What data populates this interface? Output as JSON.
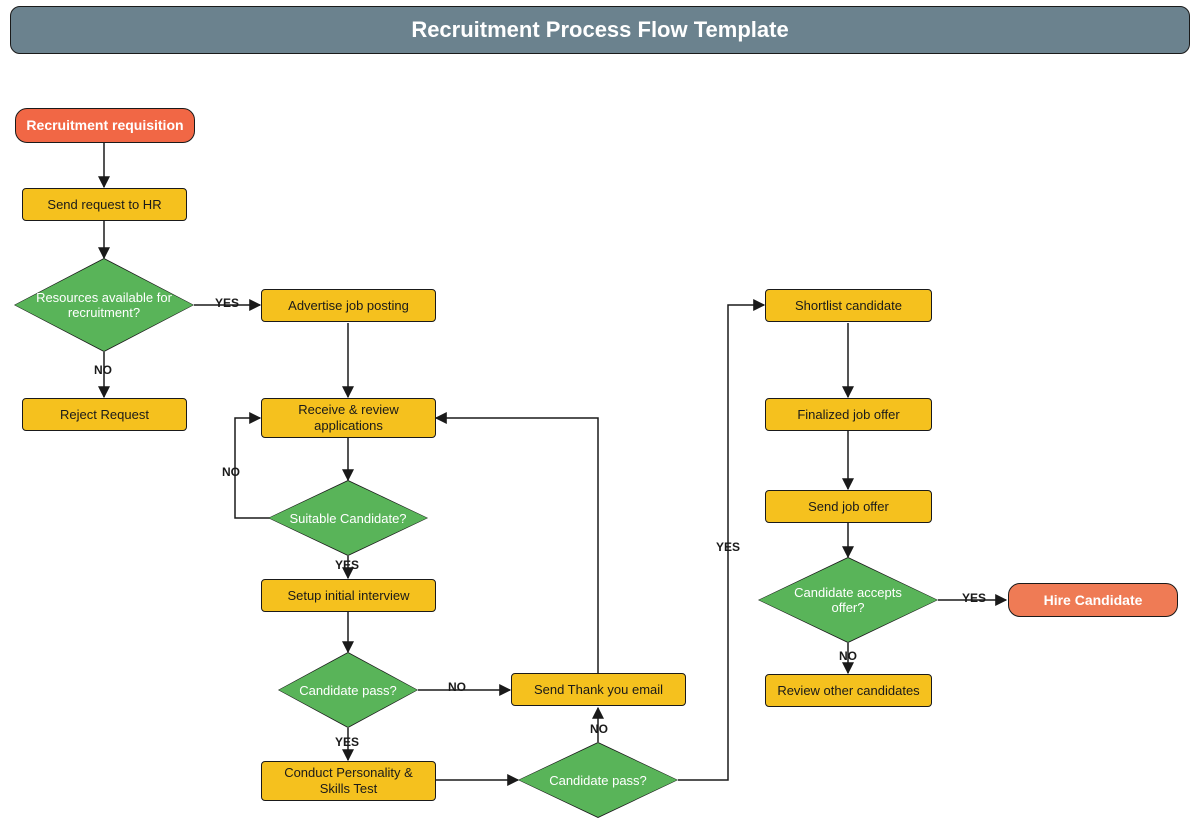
{
  "title": "Recruitment Process Flow Template",
  "colors": {
    "header": "#6b828e",
    "terminator": "#f16745",
    "terminatorEnd": "#ef7b55",
    "process": "#f5c11e",
    "decision": "#59b459",
    "stroke": "#1a1a1a"
  },
  "nodes": {
    "start": "Recruitment requisition",
    "sendHR": "Send request to HR",
    "resources": "Resources available for recruitment?",
    "reject": "Reject Request",
    "advertise": "Advertise job posting",
    "receive": "Receive & review applications",
    "suitable": "Suitable Candidate?",
    "setup": "Setup initial interview",
    "pass1": "Candidate pass?",
    "thankyou": "Send Thank you email",
    "conduct": "Conduct Personality & Skills Test",
    "pass2": "Candidate pass?",
    "shortlist": "Shortlist candidate",
    "finalize": "Finalized job offer",
    "sendoffer": "Send job offer",
    "accepts": "Candidate accepts offer?",
    "hire": "Hire Candidate",
    "reviewother": "Review other candidates"
  },
  "labels": {
    "yes": "YES",
    "no": "NO"
  },
  "chart_data": {
    "type": "flowchart",
    "title": "Recruitment Process Flow Template",
    "nodes": [
      {
        "id": "start",
        "type": "terminator",
        "label": "Recruitment requisition"
      },
      {
        "id": "sendHR",
        "type": "process",
        "label": "Send request to HR"
      },
      {
        "id": "resources",
        "type": "decision",
        "label": "Resources available for recruitment?"
      },
      {
        "id": "reject",
        "type": "process",
        "label": "Reject Request"
      },
      {
        "id": "advertise",
        "type": "process",
        "label": "Advertise job posting"
      },
      {
        "id": "receive",
        "type": "process",
        "label": "Receive & review applications"
      },
      {
        "id": "suitable",
        "type": "decision",
        "label": "Suitable Candidate?"
      },
      {
        "id": "setup",
        "type": "process",
        "label": "Setup initial interview"
      },
      {
        "id": "pass1",
        "type": "decision",
        "label": "Candidate pass?"
      },
      {
        "id": "thankyou",
        "type": "process",
        "label": "Send Thank you email"
      },
      {
        "id": "conduct",
        "type": "process",
        "label": "Conduct Personality & Skills Test"
      },
      {
        "id": "pass2",
        "type": "decision",
        "label": "Candidate pass?"
      },
      {
        "id": "shortlist",
        "type": "process",
        "label": "Shortlist candidate"
      },
      {
        "id": "finalize",
        "type": "process",
        "label": "Finalized job offer"
      },
      {
        "id": "sendoffer",
        "type": "process",
        "label": "Send job offer"
      },
      {
        "id": "accepts",
        "type": "decision",
        "label": "Candidate accepts offer?"
      },
      {
        "id": "hire",
        "type": "terminator",
        "label": "Hire Candidate"
      },
      {
        "id": "reviewother",
        "type": "process",
        "label": "Review other candidates"
      }
    ],
    "edges": [
      {
        "from": "start",
        "to": "sendHR"
      },
      {
        "from": "sendHR",
        "to": "resources"
      },
      {
        "from": "resources",
        "to": "advertise",
        "label": "YES"
      },
      {
        "from": "resources",
        "to": "reject",
        "label": "NO"
      },
      {
        "from": "advertise",
        "to": "receive"
      },
      {
        "from": "receive",
        "to": "suitable"
      },
      {
        "from": "suitable",
        "to": "setup",
        "label": "YES"
      },
      {
        "from": "suitable",
        "to": "receive",
        "label": "NO"
      },
      {
        "from": "setup",
        "to": "pass1"
      },
      {
        "from": "pass1",
        "to": "conduct",
        "label": "YES"
      },
      {
        "from": "pass1",
        "to": "thankyou",
        "label": "NO"
      },
      {
        "from": "conduct",
        "to": "pass2"
      },
      {
        "from": "pass2",
        "to": "thankyou",
        "label": "NO"
      },
      {
        "from": "pass2",
        "to": "shortlist",
        "label": "YES"
      },
      {
        "from": "shortlist",
        "to": "finalize"
      },
      {
        "from": "finalize",
        "to": "sendoffer"
      },
      {
        "from": "sendoffer",
        "to": "accepts"
      },
      {
        "from": "accepts",
        "to": "hire",
        "label": "YES"
      },
      {
        "from": "accepts",
        "to": "reviewother",
        "label": "NO"
      },
      {
        "from": "thankyou",
        "to": "receive"
      }
    ]
  }
}
